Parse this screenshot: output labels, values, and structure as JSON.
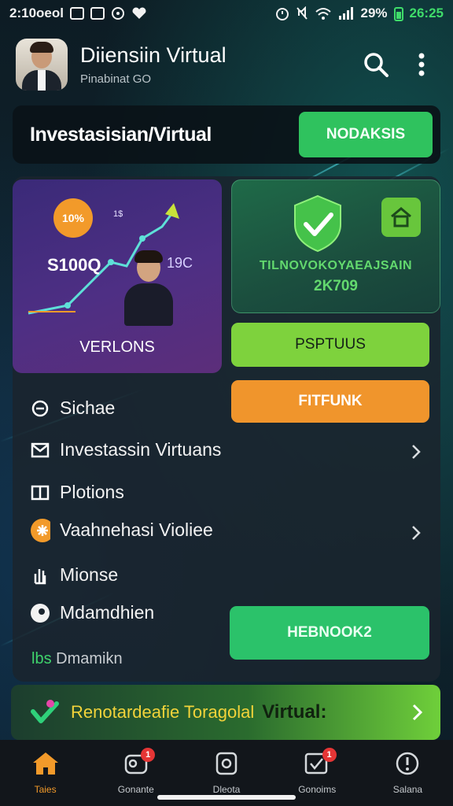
{
  "status_bar": {
    "left_text": "2:10oeol",
    "battery": "29%",
    "time": "26:25",
    "time_color": "#3fdc6a"
  },
  "header": {
    "title": "Diiensiin Virtual",
    "subtitle": "Pinabinat GO",
    "search_icon": "search-icon",
    "menu_icon": "more-vertical-icon"
  },
  "banner": {
    "title": "Investasisian/Virtual",
    "button_label": "NODAKSIS"
  },
  "card_left": {
    "badge": "10%",
    "value": "S100Q",
    "small": "1$",
    "small2": "19C",
    "label": "VERLONS"
  },
  "card_right": {
    "text": "TILNOVOKOYAEAJSAIN",
    "number": "2K709"
  },
  "buttons": {
    "status": "PSPTUUS",
    "refund": "FITFUNK",
    "hebnoor": "HEBNOOK2"
  },
  "list": [
    {
      "label": "Sichae",
      "icon": "chat-icon"
    },
    {
      "label": "Investassin Virtuans",
      "icon": "mail-icon"
    },
    {
      "label": "Plotions",
      "icon": "book-icon"
    },
    {
      "label": "Vaahnehasi Violiee",
      "icon": "star-icon"
    },
    {
      "label": "Mionse",
      "icon": "hand-icon"
    },
    {
      "label": "Mdamdhien",
      "icon": "location-icon"
    }
  ],
  "footer_label": {
    "accent": "lbs",
    "text": "Dmamikn"
  },
  "promo": {
    "text": "Renotardeafie Toragolal",
    "strong": "Virtual:"
  },
  "nav": [
    {
      "label": "Taies",
      "icon": "home-icon",
      "badge": ""
    },
    {
      "label": "Gonante",
      "icon": "group-icon",
      "badge": "1"
    },
    {
      "label": "Dleota",
      "icon": "document-icon",
      "badge": ""
    },
    {
      "label": "Gonoims",
      "icon": "checklist-icon",
      "badge": "1"
    },
    {
      "label": "Salana",
      "icon": "alert-icon",
      "badge": ""
    }
  ],
  "colors": {
    "accent_green": "#2fc25e",
    "accent_orange": "#f0952c",
    "nav_active": "#f29a2a"
  }
}
